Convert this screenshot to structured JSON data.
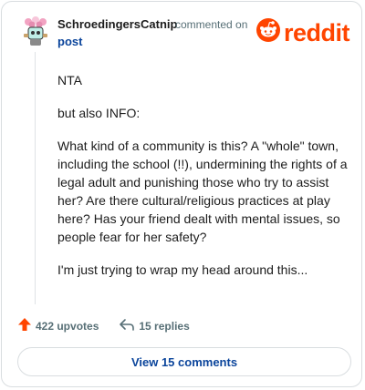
{
  "comment": {
    "author": "SchroedingersCatnip",
    "action_text": "commented on",
    "target_text": "post",
    "paragraphs": [
      "NTA",
      "but also INFO:",
      "What kind of a community is this? A \"whole\" town, including the school (!!), undermining the rights of a legal adult and punishing those who try to assist her? Are there cultural/religious practices at play here? Has your friend dealt with mental issues, so people fear for her safety?",
      "I'm just trying to wrap my head around this..."
    ]
  },
  "brand": {
    "wordmark": "reddit",
    "color": "#ff4500"
  },
  "stats": {
    "upvotes_label": "422 upvotes",
    "replies_label": "15 replies"
  },
  "footer": {
    "view_button_label": "View 15 comments"
  },
  "icons": {
    "avatar": "avatar-icon",
    "logo": "reddit-logo-icon",
    "upvote": "upvote-arrow-icon",
    "reply": "reply-arrow-icon"
  }
}
